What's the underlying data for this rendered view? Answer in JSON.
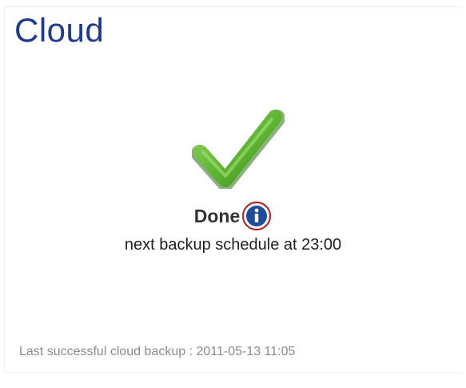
{
  "panel": {
    "title": "Cloud"
  },
  "status": {
    "icon": "checkmark-icon",
    "label": "Done",
    "info_icon": "info-icon",
    "schedule_text": "next backup schedule at 23:00"
  },
  "footer": {
    "last_backup_text": "Last successful cloud backup : 2011-05-13 11:05"
  },
  "colors": {
    "title": "#1f3a8a",
    "check_green": "#5cb531",
    "info_blue": "#1c4c9c",
    "info_ring": "#b02a2a",
    "footer_text": "#8a8a8a"
  }
}
